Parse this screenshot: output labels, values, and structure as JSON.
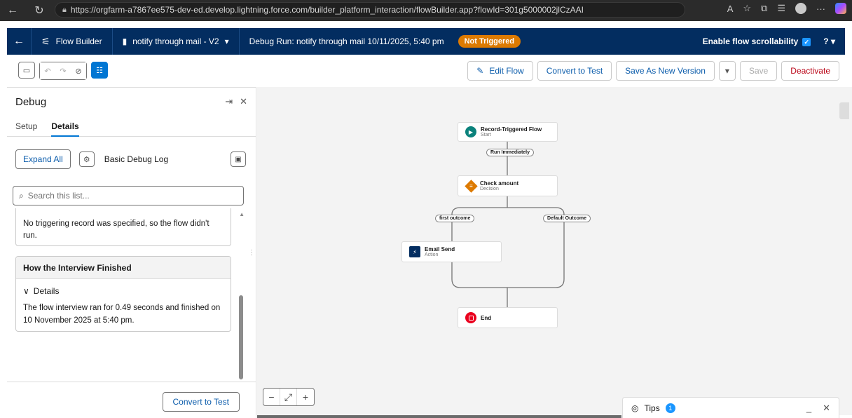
{
  "browser": {
    "url": "https://orgfarm-a7867ee575-dev-ed.develop.lightning.force.com/builder_platform_interaction/flowBuilder.app?flowId=301g5000002jlCzAAI"
  },
  "header": {
    "app_name": "Flow Builder",
    "flow_name": "notify through mail - V2",
    "debug_run": "Debug Run: notify through mail 10/11/2025, 5:40 pm",
    "status_badge": "Not Triggered",
    "scroll_toggle_label": "Enable flow scrollability",
    "help": "?"
  },
  "toolbar": {
    "edit_flow": "Edit Flow",
    "convert_to_test": "Convert to Test",
    "save_as_new_version": "Save As New Version",
    "save": "Save",
    "deactivate": "Deactivate"
  },
  "debug_panel": {
    "title": "Debug",
    "tabs": [
      "Setup",
      "Details"
    ],
    "expand_all": "Expand All",
    "log_label": "Basic Debug Log",
    "search_placeholder": "Search this list...",
    "card1_text": "No triggering record was specified, so the flow didn't run.",
    "card2_title": "How the Interview Finished",
    "card2_details": "Details",
    "card2_text": "The flow interview ran for 0.49 seconds and finished on 10 November 2025 at 5:40 pm.",
    "footer_button": "Convert to Test"
  },
  "canvas": {
    "start": {
      "title": "Record-Triggered Flow",
      "sub": "Start"
    },
    "run_pill": "Run Immediately",
    "decision": {
      "title": "Check amount",
      "sub": "Decision"
    },
    "outcome_left": "first outcome",
    "outcome_right": "Default Outcome",
    "action": {
      "title": "Email Send",
      "sub": "Action"
    },
    "end": {
      "title": "End"
    }
  },
  "tips": {
    "label": "Tips",
    "count": "1"
  },
  "colors": {
    "header_bg": "#032d60",
    "accent": "#0176d3",
    "badge": "#dd7a01",
    "deactivate": "#ba0517"
  }
}
